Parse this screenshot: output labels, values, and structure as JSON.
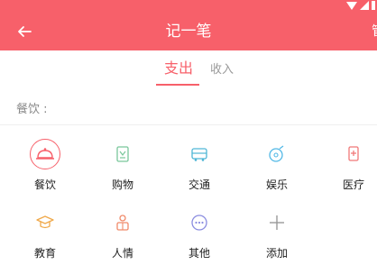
{
  "app": {
    "title": "记一笔",
    "manage_label": "管",
    "accent_color": "#f7606a"
  },
  "tabs": [
    {
      "label": "支出",
      "active": true
    },
    {
      "label": "收入",
      "active": false
    }
  ],
  "selected": {
    "label": "餐饮 :"
  },
  "categories": [
    {
      "label": "餐饮",
      "icon": "dining-cloche-icon",
      "selected": true
    },
    {
      "label": "购物",
      "icon": "shopping-bag-icon",
      "selected": false
    },
    {
      "label": "交通",
      "icon": "bus-icon",
      "selected": false
    },
    {
      "label": "娱乐",
      "icon": "entertainment-icon",
      "selected": false
    },
    {
      "label": "医疗",
      "icon": "medical-icon",
      "selected": false
    },
    {
      "label": "教育",
      "icon": "graduation-cap-icon",
      "selected": false
    },
    {
      "label": "人情",
      "icon": "person-gift-icon",
      "selected": false
    },
    {
      "label": "其他",
      "icon": "more-dots-icon",
      "selected": false
    },
    {
      "label": "添加",
      "icon": "plus-icon",
      "selected": false
    }
  ]
}
